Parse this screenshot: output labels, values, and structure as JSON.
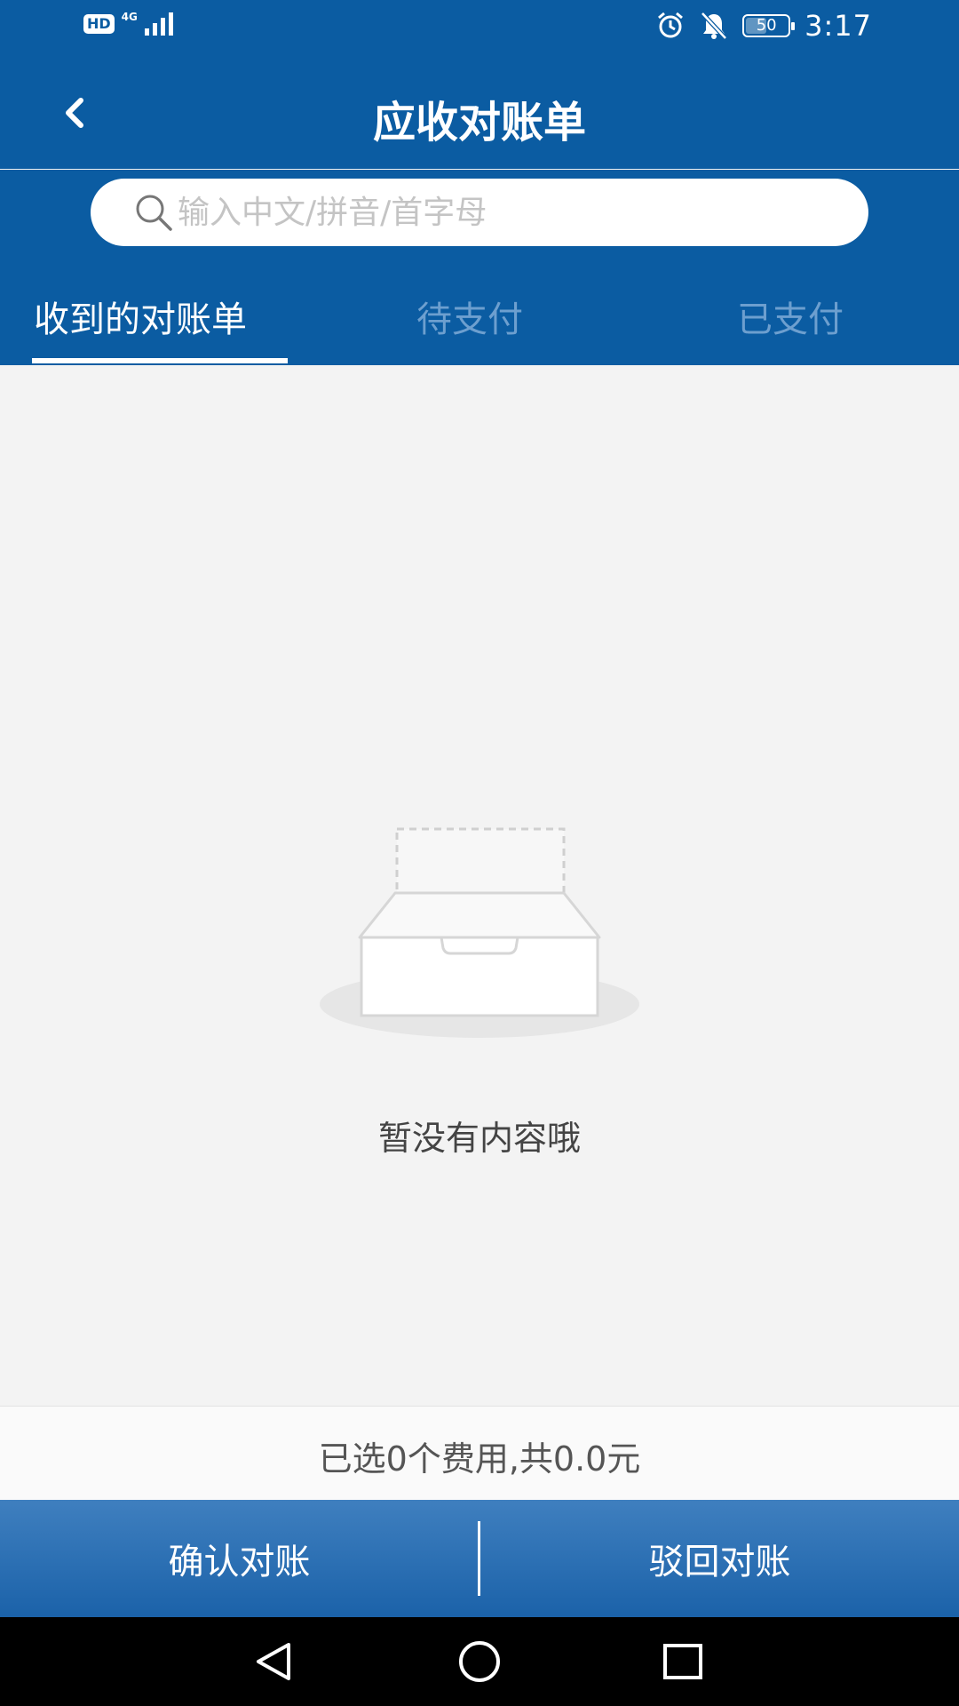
{
  "status_bar": {
    "hd": "HD",
    "network": "4G",
    "battery": "50",
    "battery_level": 0.5,
    "time": "3:17"
  },
  "header": {
    "title": "应收对账单"
  },
  "search": {
    "placeholder": "输入中文/拼音/首字母",
    "value": ""
  },
  "tabs": [
    {
      "label": "收到的对账单",
      "active": true
    },
    {
      "label": "待支付",
      "active": false
    },
    {
      "label": "已支付",
      "active": false
    }
  ],
  "empty_state": {
    "message": "暂没有内容哦"
  },
  "summary": {
    "text": "已选0个费用,共0.0元"
  },
  "actions": {
    "confirm_label": "确认对账",
    "reject_label": "驳回对账"
  },
  "colors": {
    "primary": "#0b5ca2",
    "tab_inactive": "#6d9fcf",
    "background": "#f3f3f3"
  }
}
